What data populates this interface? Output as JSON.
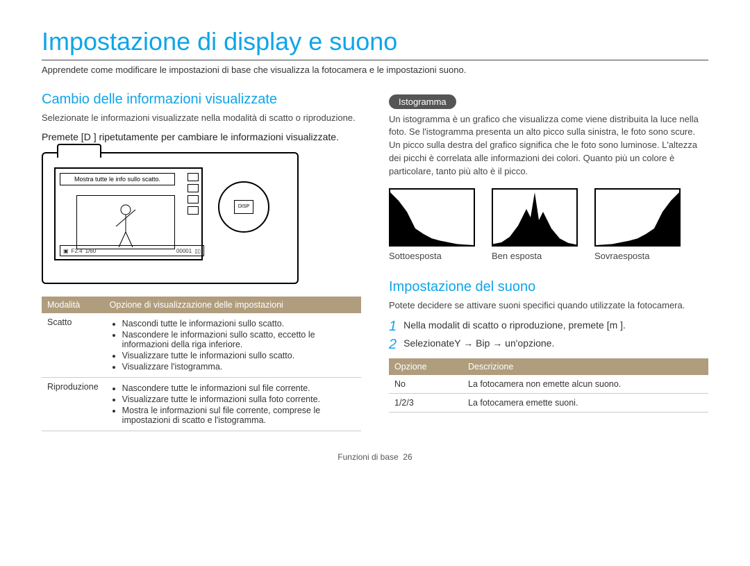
{
  "page_title": "Impostazione di display e suono",
  "intro": "Apprendete come modificare le impostazioni di base che visualizza la fotocamera e le impostazioni suono.",
  "left": {
    "heading": "Cambio delle informazioni visualizzate",
    "sub": "Selezionate le informazioni visualizzate nella modalità di scatto o riproduzione.",
    "instruction": "Premete [D       ] ripetutamente per cambiare le informazioni visualizzate.",
    "camera_overlay": "Mostra tutte le info sullo scatto.",
    "camera_bar": [
      "F2.4",
      "1/60",
      "00001"
    ],
    "camera_button": "DISP",
    "table": {
      "headers": [
        "Modalità",
        "Opzione di visualizzazione delle impostazioni"
      ],
      "rows": [
        {
          "mode": "Scatto",
          "items": [
            "Nascondi tutte le informazioni sullo scatto.",
            "Nascondere le informazioni sullo scatto, eccetto le informazioni della riga inferiore.",
            "Visualizzare tutte le informazioni sullo scatto.",
            "Visualizzare l'istogramma."
          ]
        },
        {
          "mode": "Riproduzione",
          "items": [
            "Nascondere tutte le informazioni sul file corrente.",
            "Visualizzare tutte le informazioni sulla foto corrente.",
            "Mostra le informazioni sul file corrente, comprese le impostazioni di scatto e l'istogramma."
          ]
        }
      ]
    }
  },
  "right": {
    "pill": "Istogramma",
    "histo_text": "Un istogramma è un grafico che visualizza come viene distribuita la luce nella foto. Se l'istogramma presenta un alto picco sulla sinistra, le foto sono scure. Un picco sulla destra del grafico significa che le foto sono luminose. L'altezza dei picchi è correlata alle informazioni dei colori. Quanto più un colore è particolare, tanto più alto è il picco.",
    "histo_labels": [
      "Sottoesposta",
      "Ben esposta",
      "Sovraesposta"
    ],
    "sound_heading": "Impostazione del suono",
    "sound_sub": "Potete decidere se attivare suoni specifici quando utilizzate la fotocamera.",
    "step1": "Nella modalit  di scatto o riproduzione, premete [m        ].",
    "step2": "SelezionateY     → Bip → un'opzione.",
    "sound_table": {
      "headers": [
        "Opzione",
        "Descrizione"
      ],
      "rows": [
        {
          "opt": "No",
          "desc": "La fotocamera non emette alcun suono."
        },
        {
          "opt": "1/2/3",
          "desc": "La fotocamera emette suoni."
        }
      ]
    }
  },
  "footer": {
    "label": "Funzioni di base",
    "page": "26"
  },
  "chart_data": [
    {
      "type": "area",
      "title": "Sottoesposta",
      "x": [
        0,
        10,
        20,
        30,
        40,
        50,
        60,
        70,
        80,
        90,
        100
      ],
      "values": [
        95,
        80,
        60,
        30,
        20,
        12,
        8,
        5,
        2,
        1,
        0
      ],
      "xlim": [
        0,
        100
      ],
      "ylim": [
        0,
        100
      ]
    },
    {
      "type": "area",
      "title": "Ben esposta",
      "x": [
        0,
        10,
        20,
        30,
        40,
        45,
        50,
        55,
        60,
        70,
        80,
        90,
        100
      ],
      "values": [
        2,
        5,
        15,
        35,
        65,
        50,
        95,
        45,
        60,
        30,
        12,
        4,
        1
      ],
      "xlim": [
        0,
        100
      ],
      "ylim": [
        0,
        100
      ]
    },
    {
      "type": "area",
      "title": "Sovraesposta",
      "x": [
        0,
        10,
        20,
        30,
        40,
        50,
        60,
        70,
        80,
        90,
        100
      ],
      "values": [
        0,
        1,
        2,
        5,
        8,
        12,
        20,
        30,
        60,
        80,
        95
      ],
      "xlim": [
        0,
        100
      ],
      "ylim": [
        0,
        100
      ]
    }
  ]
}
